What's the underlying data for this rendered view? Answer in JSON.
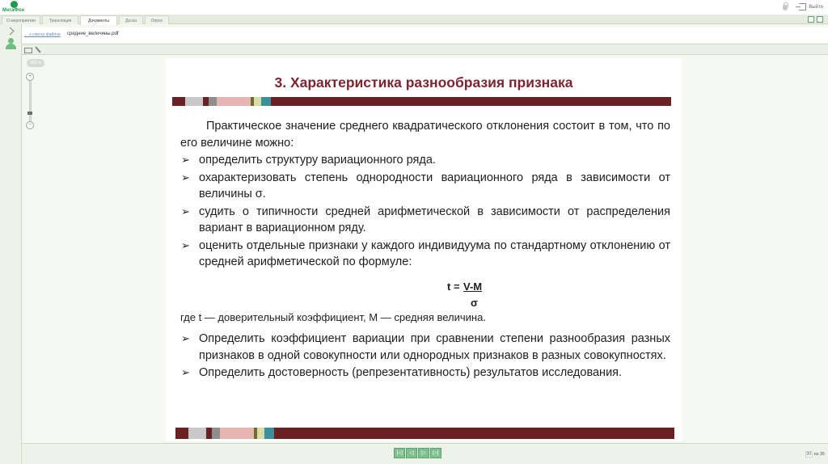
{
  "header": {
    "logo_text": "МегаФон",
    "exit_label": "Выйти"
  },
  "tabs": [
    {
      "label": "О мероприятии",
      "active": false
    },
    {
      "label": "Трансляция",
      "active": false
    },
    {
      "label": "Документы",
      "active": true
    },
    {
      "label": "Доска",
      "active": false
    },
    {
      "label": "Опрос",
      "active": false
    }
  ],
  "breadcrumb": {
    "back_label": "← к списку файлов",
    "file_name": "средние_величины.pdf"
  },
  "viewer": {
    "zoom_label": "100 %",
    "zoom_plus": "+",
    "zoom_minus": "−"
  },
  "slide": {
    "title": "3. Характеристика разнообразия признака",
    "lead": "Практическое значение среднего квадратического отклонения состоит в том, что по его величине можно:",
    "bullets": [
      "определить структуру вариационного ряда.",
      "охарактеризовать степень однородности вариационного ряда в зависимости от величины σ.",
      "судить о типичности средней арифметической в зависимости от распределения вариант в вариационном ряду.",
      "оценить отдельные признаки у каждого индивидуума по стандартному отклонению от средней арифметической по формуле:"
    ],
    "formula": {
      "lhs": "t =",
      "numerator": "V-M",
      "denominator": "σ"
    },
    "note": "где t — доверительный коэффициент, М — средняя величина.",
    "bullets2": [
      "Определить коэффициент вариации при сравнении степени разнообразия разных признаков в одной совокупности или однородных признаков в разных совокупностях.",
      "Определить достоверность (репрезентативность) результатов исследования."
    ],
    "bar_colors": {
      "dark": "#6b2024",
      "light_gray": "#c8c8c8",
      "mid_gray": "#8e8e8e",
      "pink": "#e6b4b2",
      "olive": "#6f6a2d",
      "light_olive": "#d7dca6",
      "teal": "#3a8f98"
    }
  },
  "footer": {
    "page_current": "20",
    "page_total_label": "из 35"
  },
  "colors": {
    "accent_green": "#1d9c4a",
    "title_maroon": "#7b2530"
  }
}
